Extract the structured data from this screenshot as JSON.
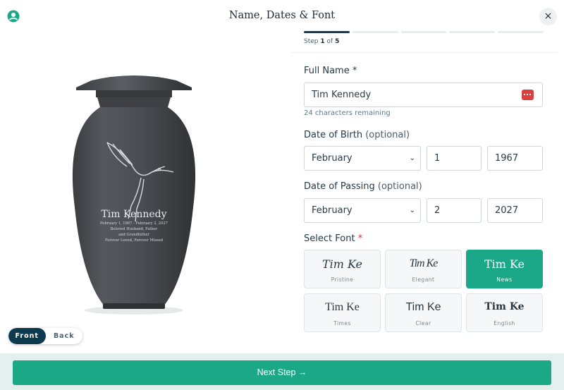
{
  "header": {
    "title": "Name, Dates & Font",
    "close_label": "×",
    "logo_icon": "brand-logo-icon"
  },
  "progress": {
    "current_step": 1,
    "total_steps": 5,
    "step_word": "Step",
    "of_word": "of"
  },
  "preview": {
    "name": "Tim Kennedy",
    "line1": "February 1, 1967 - February 2, 2027",
    "line2": "Beloved Husband, Father",
    "line3": "and Grandfather",
    "line4": "Forever Loved, Forever Missed",
    "toggle_front": "Front",
    "toggle_back": "Back"
  },
  "form": {
    "full_name_label": "Full Name",
    "required_mark": "*",
    "full_name_value": "Tim Kennedy",
    "chars_remaining": "24 characters remaining",
    "dob_label": "Date of Birth",
    "dob_optional": "(optional)",
    "dob_month": "February",
    "dob_day": "1",
    "dob_year": "1967",
    "dop_label": "Date of Passing",
    "dop_optional": "(optional)",
    "dop_month": "February",
    "dop_day": "2",
    "dop_year": "2027",
    "font_label": "Select Font",
    "font_required": "*"
  },
  "fonts": [
    {
      "sample": "Tim Ke",
      "name": "Pristine",
      "selected": false
    },
    {
      "sample": "Tim Ke",
      "name": "Elegant",
      "selected": false
    },
    {
      "sample": "Tim Ke",
      "name": "News",
      "selected": true
    },
    {
      "sample": "Tim Ke",
      "name": "Times",
      "selected": false
    },
    {
      "sample": "Tim Ke",
      "name": "Clear",
      "selected": false
    },
    {
      "sample": "Tim Ke",
      "name": "English",
      "selected": false
    }
  ],
  "footer": {
    "next_label": "Next Step →"
  },
  "colors": {
    "accent": "#1aa888",
    "dark": "#0e3a4f",
    "urn": "#4a4d51"
  }
}
